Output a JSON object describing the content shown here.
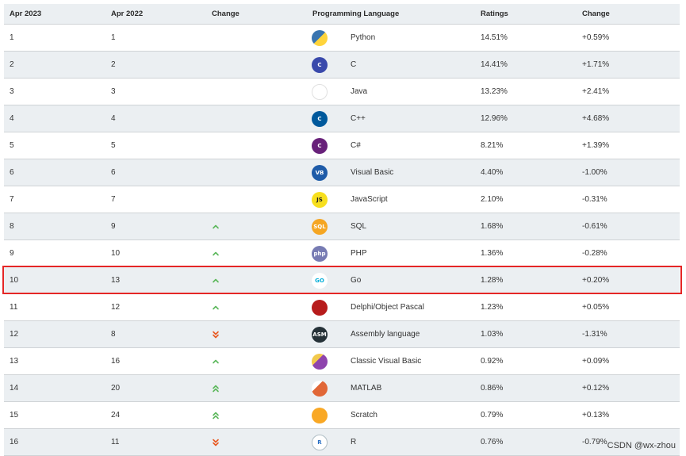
{
  "header": {
    "apr_2023": "Apr 2023",
    "apr_2022": "Apr 2022",
    "change": "Change",
    "language": "Programming Language",
    "ratings": "Ratings",
    "change_pct": "Change"
  },
  "rows": [
    {
      "cur": "1",
      "prev": "1",
      "trend": "none",
      "logo": "python-logo",
      "lang": "Python",
      "rating": "14.51%",
      "change": "+0.59%"
    },
    {
      "cur": "2",
      "prev": "2",
      "trend": "none",
      "logo": "c-logo",
      "lang": "C",
      "rating": "14.41%",
      "change": "+1.71%"
    },
    {
      "cur": "3",
      "prev": "3",
      "trend": "none",
      "logo": "java-logo",
      "lang": "Java",
      "rating": "13.23%",
      "change": "+2.41%"
    },
    {
      "cur": "4",
      "prev": "4",
      "trend": "none",
      "logo": "cpp-logo",
      "lang": "C++",
      "rating": "12.96%",
      "change": "+4.68%"
    },
    {
      "cur": "5",
      "prev": "5",
      "trend": "none",
      "logo": "csharp-logo",
      "lang": "C#",
      "rating": "8.21%",
      "change": "+1.39%"
    },
    {
      "cur": "6",
      "prev": "6",
      "trend": "none",
      "logo": "visual-basic-logo",
      "lang": "Visual Basic",
      "rating": "4.40%",
      "change": "-1.00%"
    },
    {
      "cur": "7",
      "prev": "7",
      "trend": "none",
      "logo": "javascript-logo",
      "lang": "JavaScript",
      "rating": "2.10%",
      "change": "-0.31%"
    },
    {
      "cur": "8",
      "prev": "9",
      "trend": "up",
      "logo": "sql-logo",
      "lang": "SQL",
      "rating": "1.68%",
      "change": "-0.61%"
    },
    {
      "cur": "9",
      "prev": "10",
      "trend": "up",
      "logo": "php-logo",
      "lang": "PHP",
      "rating": "1.36%",
      "change": "-0.28%"
    },
    {
      "cur": "10",
      "prev": "13",
      "trend": "up",
      "logo": "go-logo",
      "lang": "Go",
      "rating": "1.28%",
      "change": "+0.20%"
    },
    {
      "cur": "11",
      "prev": "12",
      "trend": "up",
      "logo": "delphi-logo",
      "lang": "Delphi/Object Pascal",
      "rating": "1.23%",
      "change": "+0.05%"
    },
    {
      "cur": "12",
      "prev": "8",
      "trend": "down2",
      "logo": "assembly-logo",
      "lang": "Assembly language",
      "rating": "1.03%",
      "change": "-1.31%"
    },
    {
      "cur": "13",
      "prev": "16",
      "trend": "up",
      "logo": "classic-vb-logo",
      "lang": "Classic Visual Basic",
      "rating": "0.92%",
      "change": "+0.09%"
    },
    {
      "cur": "14",
      "prev": "20",
      "trend": "up2",
      "logo": "matlab-logo",
      "lang": "MATLAB",
      "rating": "0.86%",
      "change": "+0.12%"
    },
    {
      "cur": "15",
      "prev": "24",
      "trend": "up2",
      "logo": "scratch-logo",
      "lang": "Scratch",
      "rating": "0.79%",
      "change": "+0.13%"
    },
    {
      "cur": "16",
      "prev": "11",
      "trend": "down2",
      "logo": "r-logo",
      "lang": "R",
      "rating": "0.76%",
      "change": "-0.79%"
    }
  ],
  "logo_text": {
    "c-logo": "C",
    "cpp-logo": "C",
    "csharp-logo": "C",
    "visual-basic-logo": "VB",
    "javascript-logo": "JS",
    "sql-logo": "SQL",
    "php-logo": "php",
    "go-logo": "GO",
    "assembly-logo": "ASM",
    "r-logo": "R"
  },
  "colors": {
    "row_shade": "#ebeff2",
    "trend_up": "#5cb85c",
    "trend_down": "#e8571f",
    "highlight_border": "#e52626"
  },
  "highlight_row": "10",
  "watermark": "CSDN @wx-zhou"
}
